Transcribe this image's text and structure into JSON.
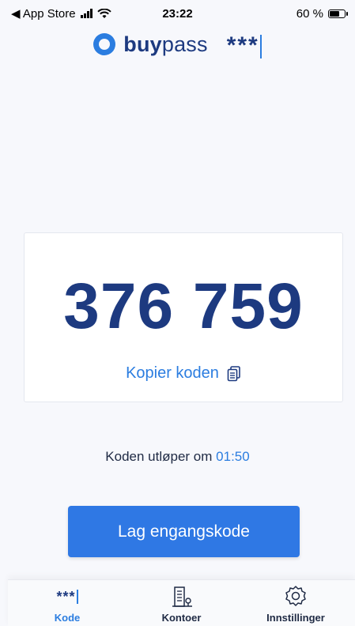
{
  "status_bar": {
    "back_label": "◀ App Store",
    "time": "23:22",
    "battery": "60 %"
  },
  "header": {
    "logo_prefix": "buy",
    "logo_suffix": "pass",
    "stars": "***"
  },
  "code_card": {
    "code": "376 759",
    "copy_label": "Kopier koden"
  },
  "expiry": {
    "label": "Koden utløper om",
    "time": "01:50"
  },
  "primary_button": {
    "label": "Lag engangskode"
  },
  "tab_bar": {
    "tabs": [
      {
        "label": "Kode",
        "icon": "stars-icon",
        "active": true
      },
      {
        "label": "Kontoer",
        "icon": "building-icon",
        "active": false
      },
      {
        "label": "Innstillinger",
        "icon": "gear-icon",
        "active": false
      }
    ]
  },
  "colors": {
    "brand_dark": "#1d3a80",
    "brand_blue": "#2b7de0",
    "button": "#2f78e4",
    "background": "#f7f8fc"
  }
}
